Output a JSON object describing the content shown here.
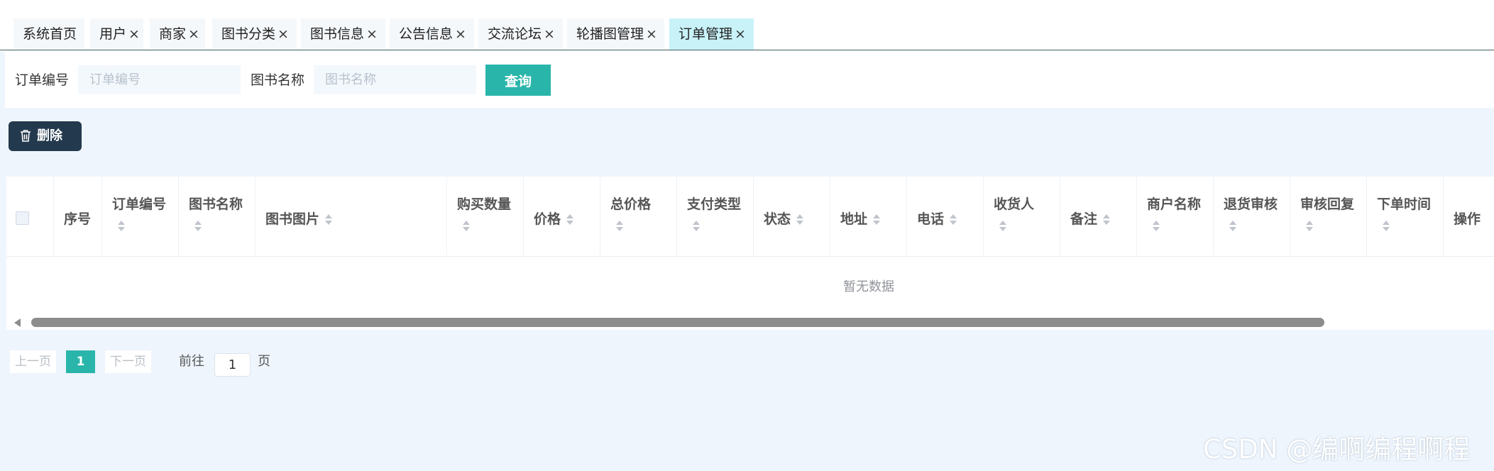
{
  "tabs": [
    {
      "label": "系统首页",
      "closable": false,
      "active": false
    },
    {
      "label": "用户",
      "closable": true,
      "active": false
    },
    {
      "label": "商家",
      "closable": true,
      "active": false
    },
    {
      "label": "图书分类",
      "closable": true,
      "active": false
    },
    {
      "label": "图书信息",
      "closable": true,
      "active": false
    },
    {
      "label": "公告信息",
      "closable": true,
      "active": false
    },
    {
      "label": "交流论坛",
      "closable": true,
      "active": false
    },
    {
      "label": "轮播图管理",
      "closable": true,
      "active": false
    },
    {
      "label": "订单管理",
      "closable": true,
      "active": true
    }
  ],
  "tab_close_glyph": "×",
  "search": {
    "order_no_label": "订单编号",
    "order_no_placeholder": "订单编号",
    "order_no_value": "",
    "book_name_label": "图书名称",
    "book_name_placeholder": "图书名称",
    "book_name_value": "",
    "query_label": "查询"
  },
  "toolbar": {
    "delete_label": "删除",
    "delete_icon": "trash-icon"
  },
  "table": {
    "columns": [
      {
        "label": "序号",
        "sortable": false
      },
      {
        "label": "订单编号",
        "sortable": true
      },
      {
        "label": "图书名称",
        "sortable": true
      },
      {
        "label": "图书图片",
        "sortable": true
      },
      {
        "label": "购买数量",
        "sortable": true
      },
      {
        "label": "价格",
        "sortable": true
      },
      {
        "label": "总价格",
        "sortable": true
      },
      {
        "label": "支付类型",
        "sortable": true
      },
      {
        "label": "状态",
        "sortable": true
      },
      {
        "label": "地址",
        "sortable": true
      },
      {
        "label": "电话",
        "sortable": true
      },
      {
        "label": "收货人",
        "sortable": true
      },
      {
        "label": "备注",
        "sortable": true
      },
      {
        "label": "商户名称",
        "sortable": true
      },
      {
        "label": "退货审核",
        "sortable": true
      },
      {
        "label": "审核回复",
        "sortable": true
      },
      {
        "label": "下单时间",
        "sortable": true
      },
      {
        "label": "操作",
        "sortable": false
      }
    ],
    "rows": [],
    "empty_text": "暂无数据"
  },
  "pagination": {
    "prev_label": "上一页",
    "current_page": "1",
    "next_label": "下一页",
    "goto_label": "前往",
    "goto_value": "1",
    "page_suffix": "页"
  },
  "watermark": "CSDN @编啊编程啊程",
  "colors": {
    "accent": "#2ab5aa",
    "active_tab": "#c8f2f8",
    "delete_button": "#23394d",
    "page_background": "#eef5fd"
  }
}
